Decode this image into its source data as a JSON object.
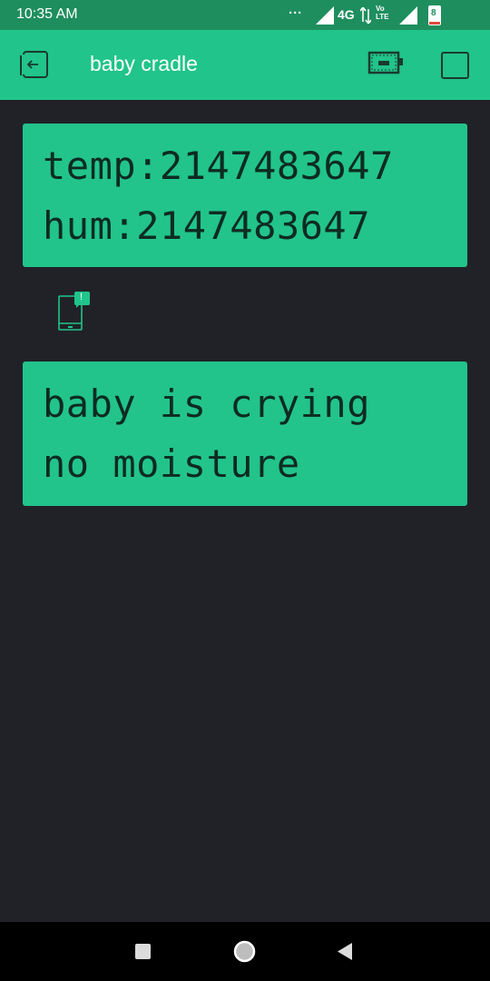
{
  "status": {
    "time": "10:35 AM",
    "dots": "···",
    "network": "4G",
    "volte": "Vo\nLTE",
    "battery": "8"
  },
  "app": {
    "title": "baby cradle"
  },
  "lcd_top": {
    "line1": "temp:2147483647",
    "line2": "hum:2147483647"
  },
  "lcd_bottom": {
    "line1": "baby is crying",
    "line2": "no moisture"
  },
  "notification": {
    "badge": "!"
  },
  "colors": {
    "status_bar": "#1f8e5e",
    "header": "#21c48b",
    "widget": "#22c48c",
    "background": "#212227",
    "lcd_text": "#0e2b22"
  },
  "icons": {
    "back": "exit-icon",
    "device": "device-battery-icon",
    "square": "square-icon",
    "notify": "phone-notification-icon",
    "nav_recents": "square-recents-icon",
    "nav_home": "circle-home-icon",
    "nav_back": "triangle-back-icon"
  }
}
